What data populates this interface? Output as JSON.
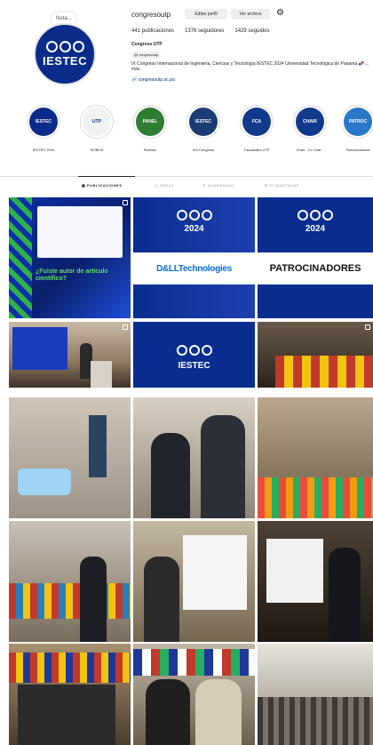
{
  "profile": {
    "username": "congresoutp",
    "edit_label": "Editar perfil",
    "archive_label": "Ver archivo",
    "note": "Nota...",
    "avatar_text": "IESTEC",
    "stats": [
      {
        "label": "441 publicaciones"
      },
      {
        "label": "1376 seguidores"
      },
      {
        "label": "1429 seguidos"
      }
    ],
    "full_name": "Congreso UTP",
    "threads_handle": "congresoutp",
    "bio": "IX Congreso Internacional de Ingeniería, Ciencias y Tecnología IESTEC 2024 Universidad Tecnológica de Panamá 🇵🇦 ... más",
    "link": "congresoutp.ac.pa"
  },
  "highlights": [
    {
      "label": "IESTEC 2024",
      "text": "IESTEC",
      "color": "#0a2b8a"
    },
    {
      "label": "ROBOS",
      "text": "UTP",
      "color": "#f2f2f2"
    },
    {
      "label": "Paneles",
      "text": "PANEL",
      "color": "#2e7d32"
    },
    {
      "label": "VIII Congreso",
      "text": "IESTEC",
      "color": "#1b3c73"
    },
    {
      "label": "Facultades UTP",
      "text": "FCA",
      "color": "#123a8c"
    },
    {
      "label": "Chair - Co Chai...",
      "text": "CHAIR",
      "color": "#123a8c"
    },
    {
      "label": "Patrocinadores",
      "text": "PATROC",
      "color": "#2a78c8"
    }
  ],
  "tabs": [
    {
      "label": "PUBLICACIONES"
    },
    {
      "label": "REELS"
    },
    {
      "label": "GUARDADAS"
    },
    {
      "label": "ETIQUETADAS"
    }
  ],
  "posts": [
    {
      "banner": "¿Fuiste autor de artículo científico?"
    },
    {
      "year": "2024",
      "banner": "D&LLTechnologies"
    },
    {
      "year": "2024",
      "banner": "PATROCINADORES"
    },
    {},
    {
      "banner": "IESTEC"
    },
    {},
    {},
    {},
    {},
    {},
    {},
    {},
    {},
    {},
    {}
  ]
}
